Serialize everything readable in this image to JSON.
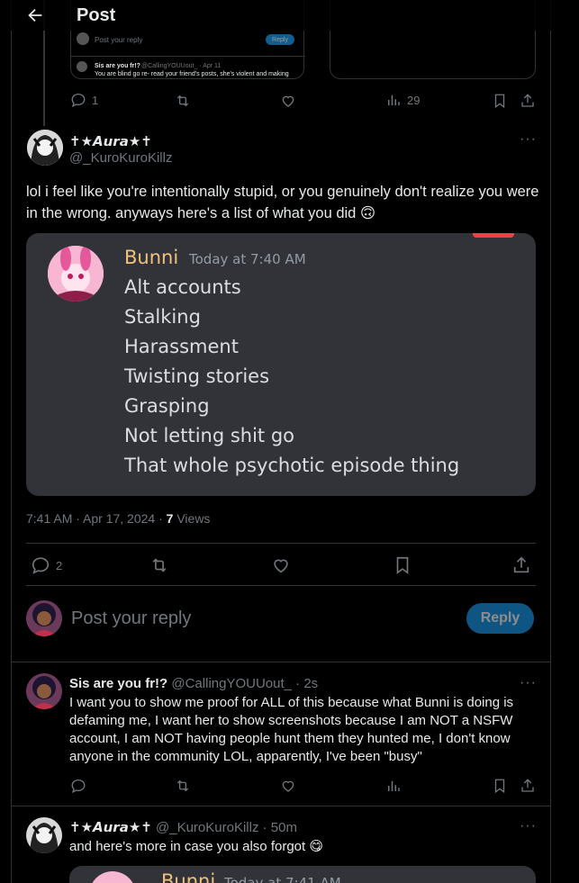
{
  "header": {
    "title": "Post"
  },
  "top_stub": {
    "reply_placeholder": "Post your reply",
    "reply_button": "Reply",
    "quoted_name": "Sis are you fr!?",
    "quoted_handle": "@CallingYOUUout_ · Apr 11",
    "quoted_text": "You are blind go re- read your friend's posts, she's violent and making",
    "counts": {
      "replies": "1",
      "views": "29"
    }
  },
  "main_post": {
    "display_name": "✝★𝘼𝙪𝙧𝙖★✝",
    "handle": "@_KuroKuroKillz",
    "text": "lol i feel like you're intentionally stupid, or you genuinely don't realize you were in the wrong. anyways here's a list of what you did 🙃",
    "timestamp": "7:41 AM · Apr 17, 2024 · ",
    "views_count": "7",
    "views_label": " Views",
    "replies_count": "2",
    "discord": {
      "author": "Bunni",
      "time": "Today at 7:40 AM",
      "lines": [
        "Alt accounts",
        "Stalking",
        "Harassment",
        "Twisting stories",
        "Grasping",
        "Not letting shit go",
        "That whole psychotic episode thing"
      ]
    }
  },
  "composer": {
    "placeholder": "Post your reply",
    "button": "Reply"
  },
  "reply1": {
    "display_name": "Sis are you fr!?",
    "handle": "@CallingYOUUout_",
    "time": "· 2s",
    "text": "I want you to show me proof for ALL of this because what Bunni is doing is defaming me, I want her to show screenshots because I am NOT a NSFW account, I am NOT having people hunt them they hunted me, I don't know anyone in the community LOL, apparently, I've been \"busy\""
  },
  "reply2": {
    "display_name": "✝★𝘼𝙪𝙧𝙖★✝",
    "handle": "@_KuroKuroKillz",
    "time": "· 50m",
    "text": "and here's more in case you also forgot 😋",
    "discord_author": "Bunni",
    "discord_time": "Today at 7:41 AM"
  },
  "colors": {
    "accent": "#1d9bf0",
    "discord_bg": "#313338",
    "discord_name": "#f0c27b",
    "muted": "#71767b"
  }
}
